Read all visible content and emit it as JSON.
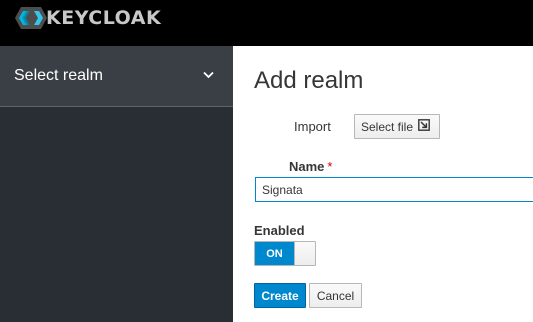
{
  "header": {
    "brand": "KEYCLOAK",
    "logo_icon": "keycloak-logo-icon"
  },
  "sidebar": {
    "realm_selector": {
      "label": "Select realm",
      "icon": "chevron-down-icon"
    }
  },
  "main": {
    "title": "Add realm",
    "import": {
      "label": "Import",
      "button_label": "Select file",
      "button_icon": "import-icon"
    },
    "name": {
      "label": "Name",
      "required_mark": "*",
      "value": "Signata"
    },
    "enabled": {
      "label": "Enabled",
      "toggle_text": "ON",
      "state": true
    },
    "actions": {
      "create_label": "Create",
      "cancel_label": "Cancel"
    }
  },
  "colors": {
    "topbar": "#000000",
    "sidebar": "#292e34",
    "sidebar_selector": "#393f44",
    "primary": "#0088ce",
    "required": "#cc0000"
  }
}
